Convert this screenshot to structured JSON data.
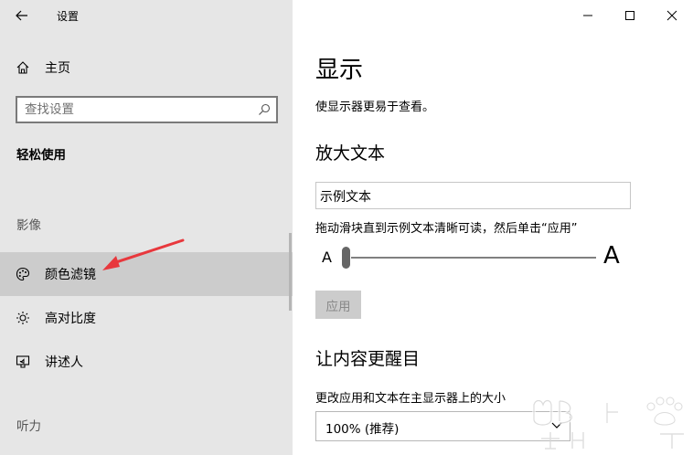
{
  "window": {
    "title": "设置"
  },
  "sidebar": {
    "home_label": "主页",
    "search_placeholder": "查找设置",
    "section_title": "轻松使用",
    "group_vision": "影像",
    "items": [
      {
        "label": "颜色滤镜",
        "icon": "palette-icon",
        "selected": true
      },
      {
        "label": "高对比度",
        "icon": "brightness-icon",
        "selected": false
      },
      {
        "label": "讲述人",
        "icon": "narrator-icon",
        "selected": false
      }
    ],
    "group_hearing": "听力"
  },
  "main": {
    "title": "显示",
    "subtitle": "使显示器更易于查看。",
    "enlarge_text_heading": "放大文本",
    "sample_text": "示例文本",
    "slider_hint": "拖动滑块直到示例文本清晰可读，然后单击“应用”",
    "slider_small_label": "A",
    "slider_large_label": "A",
    "slider_value": 0,
    "apply_label": "应用",
    "bigger_heading": "让内容更醒目",
    "scale_label": "更改应用和文本在主显示器上的大小",
    "scale_value": "100% (推荐)"
  },
  "colors": {
    "accent_arrow": "#e8383d",
    "selected_bg": "#cccccc"
  }
}
